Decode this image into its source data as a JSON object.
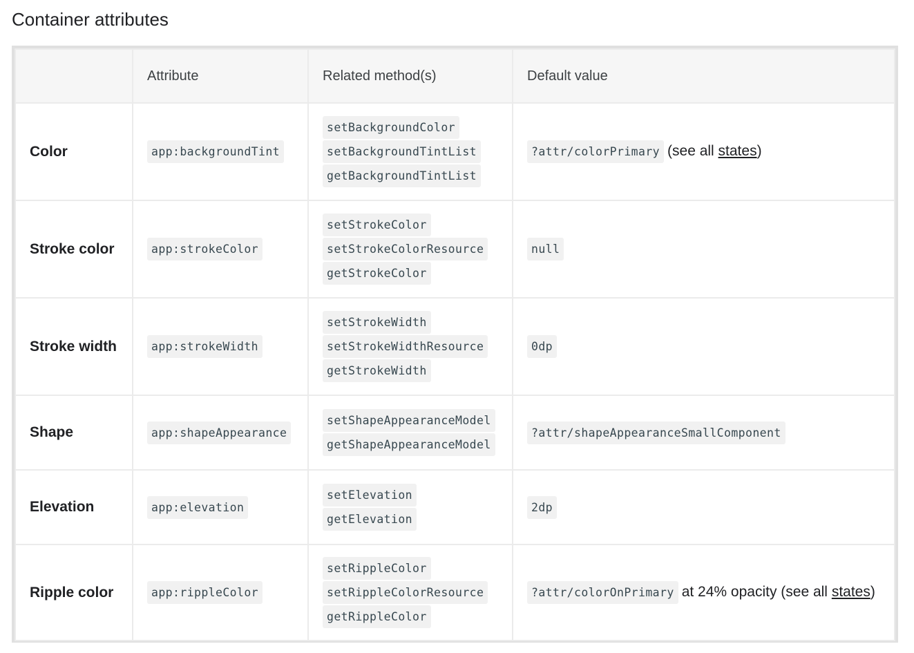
{
  "page_title": "Container attributes",
  "table": {
    "headers": [
      "",
      "Attribute",
      "Related method(s)",
      "Default value"
    ],
    "rows": [
      {
        "name": "Color",
        "attribute": "app:backgroundTint",
        "methods": [
          "setBackgroundColor",
          "setBackgroundTintList",
          "getBackgroundTintList"
        ],
        "default_code": "?attr/colorPrimary",
        "default_pre": "(see all ",
        "default_link": "states",
        "default_post": ")"
      },
      {
        "name": "Stroke color",
        "attribute": "app:strokeColor",
        "methods": [
          "setStrokeColor",
          "setStrokeColorResource",
          "getStrokeColor"
        ],
        "default_code": "null"
      },
      {
        "name": "Stroke width",
        "attribute": "app:strokeWidth",
        "methods": [
          "setStrokeWidth",
          "setStrokeWidthResource",
          "getStrokeWidth"
        ],
        "default_code": "0dp"
      },
      {
        "name": "Shape",
        "attribute": "app:shapeAppearance",
        "methods": [
          "setShapeAppearanceModel",
          "getShapeAppearanceModel"
        ],
        "default_code": "?attr/shapeAppearanceSmallComponent"
      },
      {
        "name": "Elevation",
        "attribute": "app:elevation",
        "methods": [
          "setElevation",
          "getElevation"
        ],
        "default_code": "2dp"
      },
      {
        "name": "Ripple color",
        "attribute": "app:rippleColor",
        "methods": [
          "setRippleColor",
          "setRippleColorResource",
          "getRippleColor"
        ],
        "default_code": "?attr/colorOnPrimary",
        "default_pre": "at 24% opacity (see all ",
        "default_link": "states",
        "default_post": ")"
      }
    ]
  },
  "colors": {
    "text": "#202124",
    "code_bg": "#f1f1f1",
    "header_bg": "#f6f6f6",
    "border": "#e0e0e0"
  }
}
